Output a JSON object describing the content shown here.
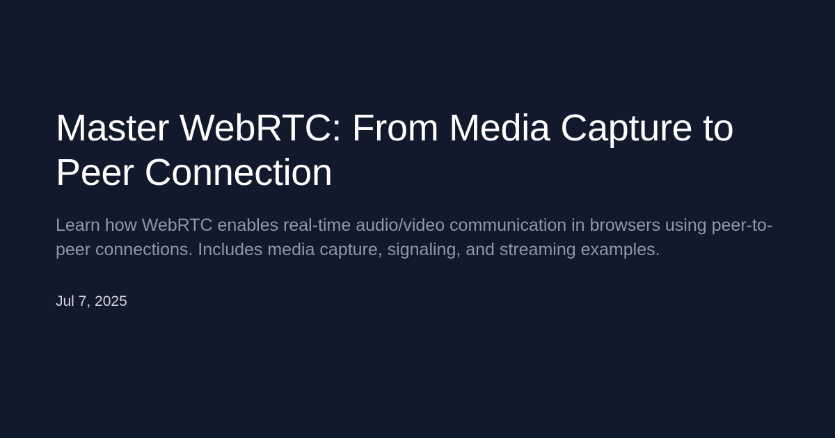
{
  "post": {
    "title": "Master WebRTC: From Media Capture to Peer Connection",
    "description": "Learn how WebRTC enables real-time audio/video communication in browsers using peer-to-peer connections. Includes media capture, signaling, and streaming examples.",
    "date": "Jul 7, 2025"
  },
  "colors": {
    "background": "#111a2c",
    "title": "#ffffff",
    "description": "#8e97a7",
    "date": "#d3d7de"
  }
}
